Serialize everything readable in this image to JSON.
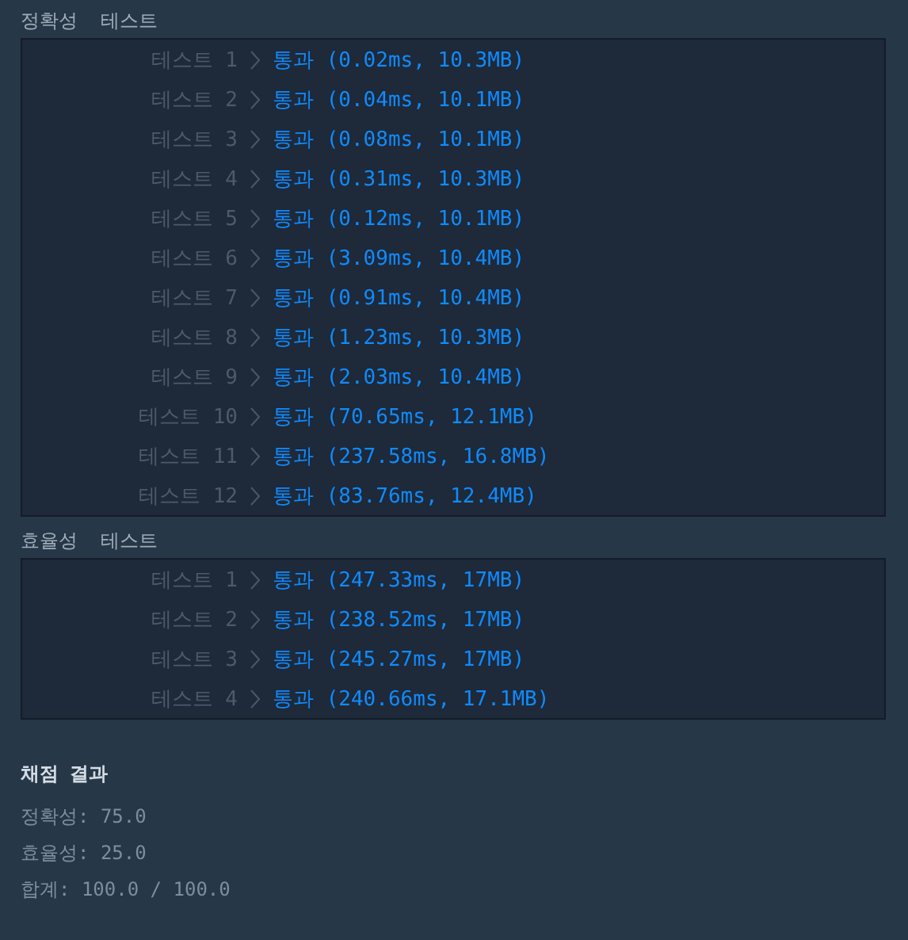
{
  "sections": [
    {
      "title": "정확성  테스트",
      "tests": [
        {
          "label": "테스트 1",
          "result": "통과 (0.02ms, 10.3MB)",
          "passed": true
        },
        {
          "label": "테스트 2",
          "result": "통과 (0.04ms, 10.1MB)",
          "passed": true
        },
        {
          "label": "테스트 3",
          "result": "통과 (0.08ms, 10.1MB)",
          "passed": true
        },
        {
          "label": "테스트 4",
          "result": "통과 (0.31ms, 10.3MB)",
          "passed": true
        },
        {
          "label": "테스트 5",
          "result": "통과 (0.12ms, 10.1MB)",
          "passed": true
        },
        {
          "label": "테스트 6",
          "result": "통과 (3.09ms, 10.4MB)",
          "passed": true
        },
        {
          "label": "테스트 7",
          "result": "통과 (0.91ms, 10.4MB)",
          "passed": true
        },
        {
          "label": "테스트 8",
          "result": "통과 (1.23ms, 10.3MB)",
          "passed": true
        },
        {
          "label": "테스트 9",
          "result": "통과 (2.03ms, 10.4MB)",
          "passed": true
        },
        {
          "label": "테스트 10",
          "result": "통과 (70.65ms, 12.1MB)",
          "passed": true
        },
        {
          "label": "테스트 11",
          "result": "통과 (237.58ms, 16.8MB)",
          "passed": true
        },
        {
          "label": "테스트 12",
          "result": "통과 (83.76ms, 12.4MB)",
          "passed": true
        }
      ]
    },
    {
      "title": "효율성  테스트",
      "tests": [
        {
          "label": "테스트 1",
          "result": "통과 (247.33ms, 17MB)",
          "passed": true
        },
        {
          "label": "테스트 2",
          "result": "통과 (238.52ms, 17MB)",
          "passed": true
        },
        {
          "label": "테스트 3",
          "result": "통과 (245.27ms, 17MB)",
          "passed": true
        },
        {
          "label": "테스트 4",
          "result": "통과 (240.66ms, 17.1MB)",
          "passed": true
        }
      ]
    }
  ],
  "summary": {
    "title": "채점 결과",
    "lines": [
      "정확성: 75.0",
      "효율성: 25.0",
      "합계: 100.0 / 100.0"
    ]
  }
}
